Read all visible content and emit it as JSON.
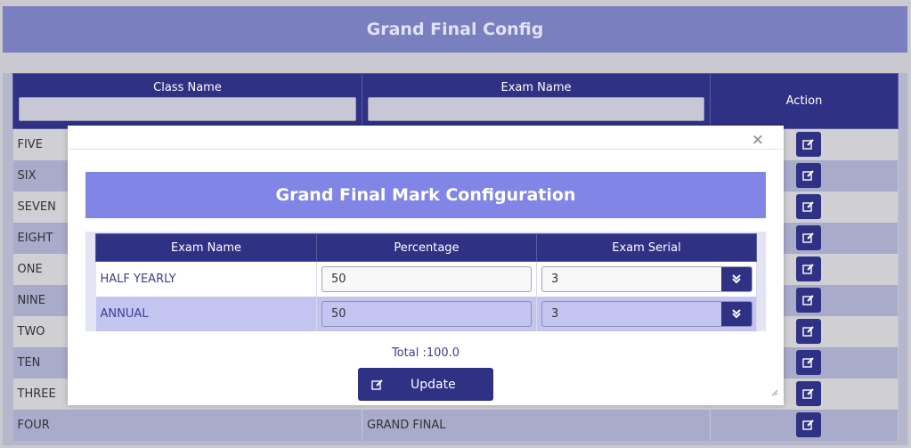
{
  "page": {
    "title": "Grand Final Config"
  },
  "table": {
    "headers": {
      "class_name": "Class Name",
      "exam_name": "Exam Name",
      "action": "Action"
    },
    "rows": [
      {
        "class_name": "FIVE",
        "exam_name": ""
      },
      {
        "class_name": "SIX",
        "exam_name": ""
      },
      {
        "class_name": "SEVEN",
        "exam_name": ""
      },
      {
        "class_name": "EIGHT",
        "exam_name": ""
      },
      {
        "class_name": "ONE",
        "exam_name": ""
      },
      {
        "class_name": "NINE",
        "exam_name": ""
      },
      {
        "class_name": "TWO",
        "exam_name": ""
      },
      {
        "class_name": "TEN",
        "exam_name": ""
      },
      {
        "class_name": "THREE",
        "exam_name": ""
      },
      {
        "class_name": "FOUR",
        "exam_name": "GRAND FINAL"
      }
    ]
  },
  "modal": {
    "close": "×",
    "title": "Grand Final Mark Configuration",
    "headers": {
      "exam_name": "Exam Name",
      "percentage": "Percentage",
      "exam_serial": "Exam Serial"
    },
    "rows": [
      {
        "exam_name": "HALF YEARLY",
        "percentage": "50",
        "serial": "3"
      },
      {
        "exam_name": "ANNUAL",
        "percentage": "50",
        "serial": "3"
      }
    ],
    "total": "Total :100.0",
    "update_label": "Update"
  },
  "icons": {
    "edit": "edit-icon",
    "dropdown": "chevron-double-down-icon",
    "close": "close-icon",
    "resize": "resize-handle-icon"
  },
  "colors": {
    "primary": "#2f3185",
    "header_bg": "#7a7fbf",
    "modal_title_bg": "#8185e6"
  }
}
